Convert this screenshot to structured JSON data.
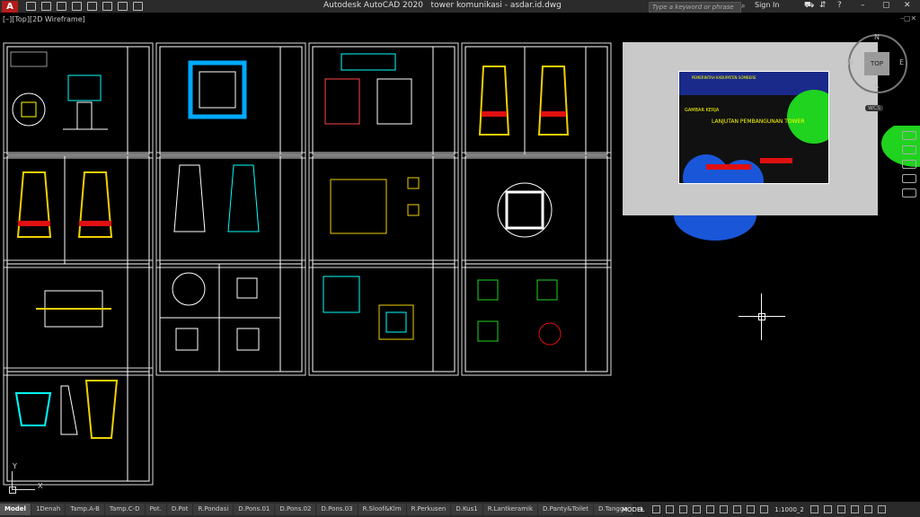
{
  "app": {
    "logo": "A",
    "title": "Autodesk AutoCAD 2020",
    "filename": "tower komunikasi - asdar.id.dwg",
    "search_placeholder": "Type a keyword or phrase",
    "signin": "Sign In"
  },
  "viewport": {
    "label": "[–][Top][2D Wireframe]"
  },
  "viewcube": {
    "top": "TOP",
    "north": "N",
    "south": "S",
    "east": "E",
    "west": "W",
    "wcs": "WCS"
  },
  "ucs": {
    "x": "X",
    "y": "Y"
  },
  "statusbar": {
    "tabs": [
      "Model",
      "1Denah",
      "Tamp.A-B",
      "Tamp.C-D",
      "Pot.",
      "D.Pot",
      "R.Pondasi",
      "D.Pons.01",
      "D.Pons.02",
      "D.Pons.03",
      "R.Sloof&Klm",
      "R.Perkusen",
      "D.Kus1",
      "R.Lantkeramik",
      "D.Panty&Toilet",
      "D.Tangga"
    ],
    "add_tab": "+",
    "model": "MODEL",
    "scale": "1:1000_2"
  },
  "preview": {
    "line1": "PEMERINTAH KABUPATEN SOMBERE",
    "subtitle": "GAMBAR KERJA",
    "heading": "LANJUTAN PEMBANGUNAN TOWER"
  },
  "colors": {
    "accent_red": "#e01010",
    "tower_yellow": "#f0d000",
    "cyan": "#00d5ff",
    "green": "#1fd31f",
    "blue": "#1a56d8"
  }
}
